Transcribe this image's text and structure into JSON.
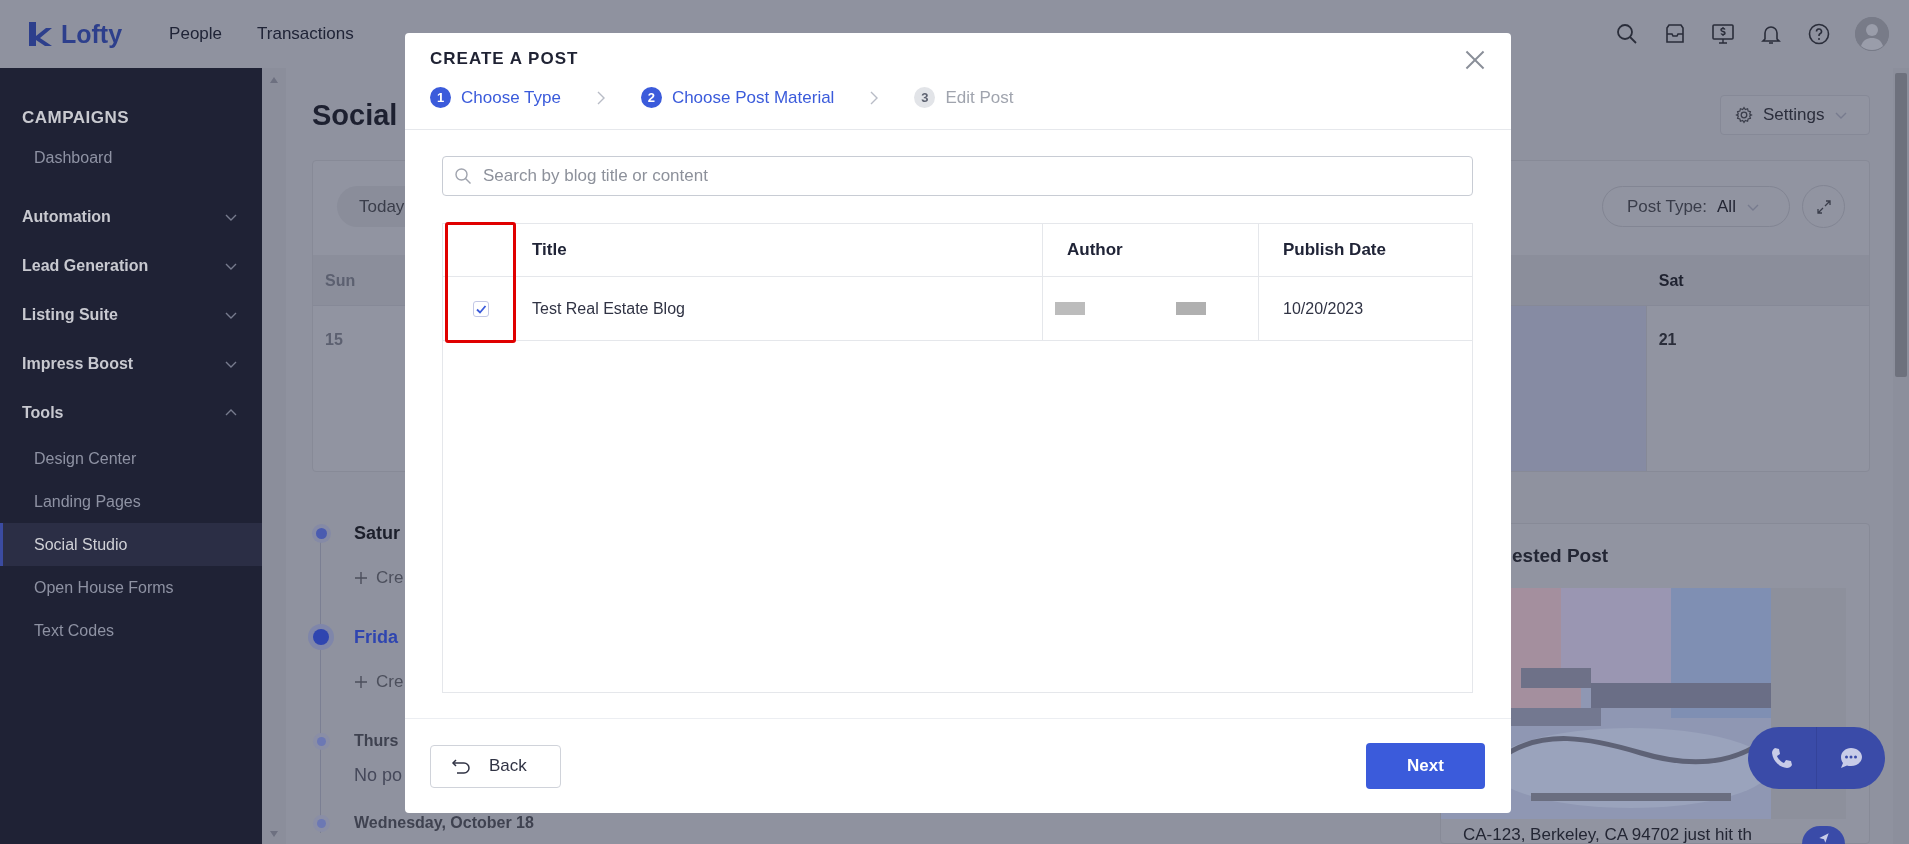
{
  "nav": {
    "brand": "Lofty",
    "items": [
      {
        "label": "People",
        "selected": false,
        "dot": false
      },
      {
        "label": "Transactions",
        "selected": false,
        "dot": false
      }
    ]
  },
  "sidebar": {
    "heading": "CAMPAIGNS",
    "items": [
      {
        "kind": "link",
        "label": "Dashboard",
        "selected": false
      },
      {
        "kind": "group",
        "label": "Automation",
        "expanded": false
      },
      {
        "kind": "group",
        "label": "Lead Generation",
        "expanded": false
      },
      {
        "kind": "group",
        "label": "Listing Suite",
        "expanded": false
      },
      {
        "kind": "group",
        "label": "Impress Boost",
        "expanded": false
      },
      {
        "kind": "group",
        "label": "Tools",
        "expanded": true,
        "children": [
          {
            "label": "Design Center",
            "selected": false
          },
          {
            "label": "Landing Pages",
            "selected": false
          },
          {
            "label": "Social Studio",
            "selected": true
          },
          {
            "label": "Open House Forms",
            "selected": false
          },
          {
            "label": "Text Codes",
            "selected": false
          }
        ]
      }
    ]
  },
  "page": {
    "title": "Social",
    "settings_button": "Settings"
  },
  "calendar": {
    "today_button": "Today",
    "post_type_label": "Post Type:",
    "post_type_value": "All",
    "days": [
      {
        "label": "Sun",
        "date": "15"
      },
      {
        "label": "Sat",
        "date": "21"
      }
    ]
  },
  "timeline": [
    {
      "kind": "day",
      "label": "Satur",
      "today": false,
      "past": false
    },
    {
      "kind": "create",
      "label": "Cre"
    },
    {
      "kind": "day",
      "label": "Frida",
      "today": true,
      "past": false
    },
    {
      "kind": "create",
      "label": "Cre"
    },
    {
      "kind": "day",
      "label": "Thurs",
      "today": false,
      "past": true
    },
    {
      "kind": "empty",
      "label": "No po"
    },
    {
      "kind": "day",
      "label": "Wednesday, October 18",
      "today": false,
      "past": true
    }
  ],
  "suggested_post": {
    "title": "ested Post",
    "caption": "CA-123, Berkeley, CA 94702 just hit th"
  },
  "dialog": {
    "title": "CREATE A POST",
    "steps": [
      {
        "number": "1",
        "label": "Choose Type",
        "reached": true
      },
      {
        "number": "2",
        "label": "Choose Post Material",
        "reached": true
      },
      {
        "number": "3",
        "label": "Edit Post",
        "reached": false
      }
    ],
    "search": {
      "placeholder": "Search by blog title or content"
    },
    "table": {
      "checkbox_column_highlighted": true,
      "columns": [
        "Title",
        "Author",
        "Publish Date"
      ],
      "rows": [
        {
          "checked": true,
          "title": "Test Real Estate Blog",
          "author_hidden": true,
          "publish_date": "10/20/2023"
        }
      ]
    },
    "back_button": "Back",
    "next_button": "Next"
  }
}
